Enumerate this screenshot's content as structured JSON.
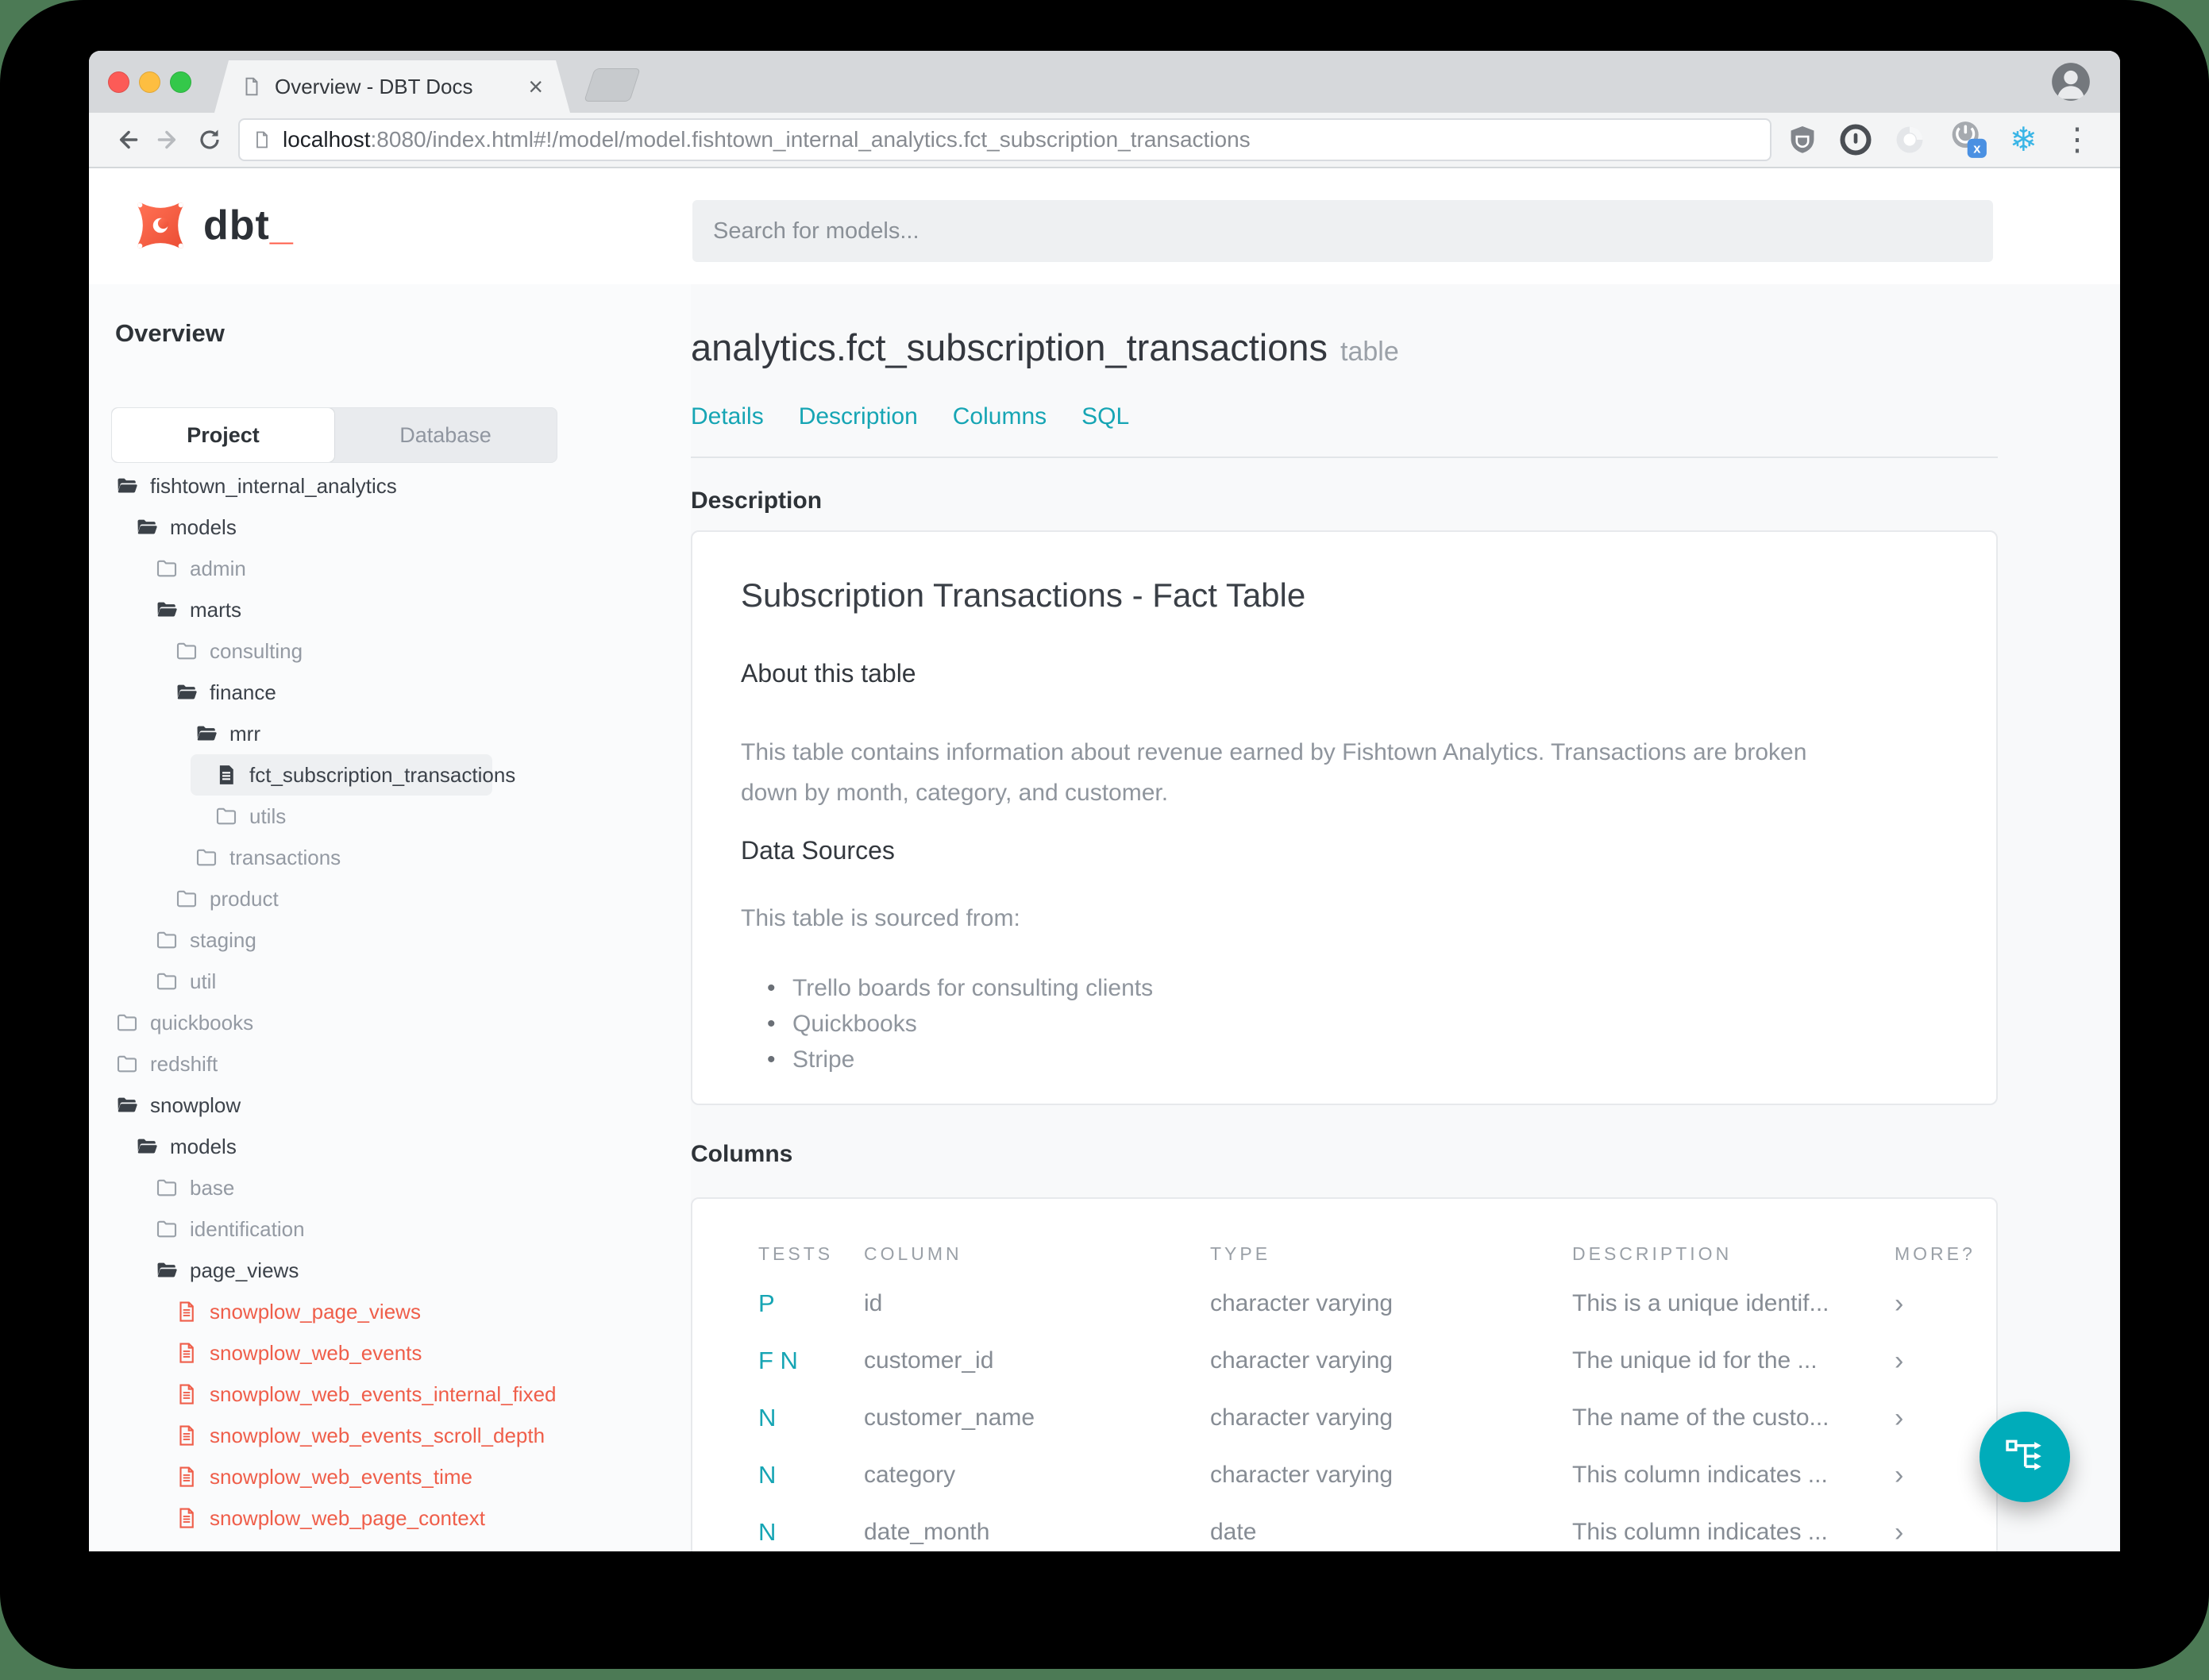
{
  "colors": {
    "teal_link": "#16a5b4",
    "teal_fab": "#00acba",
    "brand_orange": "#ff5c49",
    "red_item": "#ef5e4a",
    "traffic_red": "#fc5b57",
    "traffic_yellow": "#fdbe41",
    "traffic_green": "#34c84a",
    "badge_blue": "#4a90e2",
    "snowflake_blue": "#3ab5e6"
  },
  "icons": {
    "snowflake": "❄",
    "kebab": "⋮",
    "tab_close": "×",
    "more_chevron": "›"
  },
  "browser": {
    "tab": {
      "title": "Overview - DBT Docs"
    },
    "toolbar": {
      "url_host": "localhost",
      "url_path": ":8080/index.html#!/model/model.fishtown_internal_analytics.fct_subscription_transactions",
      "badge_label": "x"
    }
  },
  "header": {
    "logo_text": "dbt",
    "logo_cursor": "_",
    "search_placeholder": "Search for models..."
  },
  "sidebar": {
    "heading": "Overview",
    "toggle": {
      "project": "Project",
      "database": "Database"
    },
    "tree": [
      {
        "label": "fishtown_internal_analytics",
        "icon": "folder-open",
        "level": 0,
        "tone": "dark"
      },
      {
        "label": "models",
        "icon": "folder-open",
        "level": 1,
        "tone": "dark"
      },
      {
        "label": "admin",
        "icon": "folder",
        "level": 2,
        "tone": "muted"
      },
      {
        "label": "marts",
        "icon": "folder-open",
        "level": 2,
        "tone": "dark"
      },
      {
        "label": "consulting",
        "icon": "folder",
        "level": 3,
        "tone": "muted"
      },
      {
        "label": "finance",
        "icon": "folder-open",
        "level": 3,
        "tone": "dark"
      },
      {
        "label": "mrr",
        "icon": "folder-open",
        "level": 4,
        "tone": "dark"
      },
      {
        "label": "fct_subscription_transactions",
        "icon": "file",
        "level": 5,
        "tone": "dark",
        "selected": true
      },
      {
        "label": "utils",
        "icon": "folder",
        "level": 5,
        "tone": "muted"
      },
      {
        "label": "transactions",
        "icon": "folder",
        "level": 4,
        "tone": "muted"
      },
      {
        "label": "product",
        "icon": "folder",
        "level": 3,
        "tone": "muted"
      },
      {
        "label": "staging",
        "icon": "folder",
        "level": 2,
        "tone": "muted"
      },
      {
        "label": "util",
        "icon": "folder",
        "level": 2,
        "tone": "muted"
      },
      {
        "label": "quickbooks",
        "icon": "folder",
        "level": 0,
        "tone": "muted"
      },
      {
        "label": "redshift",
        "icon": "folder",
        "level": 0,
        "tone": "muted"
      },
      {
        "label": "snowplow",
        "icon": "folder-open",
        "level": 0,
        "tone": "dark"
      },
      {
        "label": "models",
        "icon": "folder-open",
        "level": 1,
        "tone": "dark"
      },
      {
        "label": "base",
        "icon": "folder",
        "level": 2,
        "tone": "muted"
      },
      {
        "label": "identification",
        "icon": "folder",
        "level": 2,
        "tone": "muted"
      },
      {
        "label": "page_views",
        "icon": "folder-open",
        "level": 2,
        "tone": "dark"
      },
      {
        "label": "snowplow_page_views",
        "icon": "file-red",
        "level": 3,
        "tone": "red"
      },
      {
        "label": "snowplow_web_events",
        "icon": "file-red",
        "level": 3,
        "tone": "red"
      },
      {
        "label": "snowplow_web_events_internal_fixed",
        "icon": "file-red",
        "level": 3,
        "tone": "red"
      },
      {
        "label": "snowplow_web_events_scroll_depth",
        "icon": "file-red",
        "level": 3,
        "tone": "red"
      },
      {
        "label": "snowplow_web_events_time",
        "icon": "file-red",
        "level": 3,
        "tone": "red"
      },
      {
        "label": "snowplow_web_page_context",
        "icon": "file-red",
        "level": 3,
        "tone": "red"
      }
    ]
  },
  "main": {
    "title": "analytics.fct_subscription_transactions",
    "title_badge": "table",
    "nav_links": [
      "Details",
      "Description",
      "Columns",
      "SQL"
    ],
    "description_heading": "Description",
    "description_card": {
      "title": "Subscription Transactions - Fact Table",
      "about_heading": "About this table",
      "about_text": "This table contains information about revenue earned by Fishtown Analytics. Transactions are broken down by month, category, and customer.",
      "sources_heading": "Data Sources",
      "sources_intro": "This table is sourced from:",
      "sources": [
        "Trello boards for consulting clients",
        "Quickbooks",
        "Stripe"
      ]
    },
    "columns_heading": "Columns",
    "columns_table": {
      "headers": [
        "TESTS",
        "COLUMN",
        "TYPE",
        "DESCRIPTION",
        "MORE?"
      ],
      "rows": [
        {
          "tests": "P",
          "column": "id",
          "type": "character varying",
          "description": "This is a unique identif...",
          "more": "›"
        },
        {
          "tests": "F N",
          "column": "customer_id",
          "type": "character varying",
          "description": "The unique id for the ...",
          "more": "›"
        },
        {
          "tests": "N",
          "column": "customer_name",
          "type": "character varying",
          "description": "The name of the custo...",
          "more": "›"
        },
        {
          "tests": "N",
          "column": "category",
          "type": "character varying",
          "description": "This column indicates ...",
          "more": "›"
        },
        {
          "tests": "N",
          "column": "date_month",
          "type": "date",
          "description": "This column indicates ...",
          "more": "›"
        }
      ]
    }
  }
}
